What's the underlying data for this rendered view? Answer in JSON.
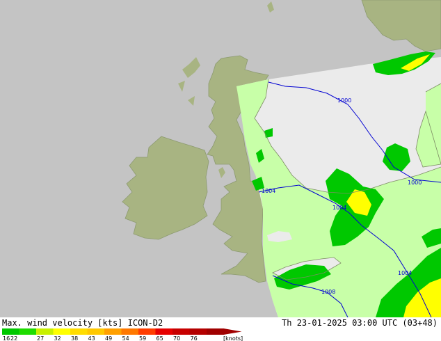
{
  "header": {
    "title": "Max. wind velocity [kts] ICON-D2",
    "valid_time": "Th 23-01-2025 03:00 UTC (03+48)"
  },
  "legend": {
    "ticks": [
      "16",
      "22",
      "27",
      "32",
      "38",
      "43",
      "49",
      "54",
      "59",
      "65",
      "70",
      "76"
    ],
    "unit": "[knots]",
    "colors": [
      "#00c800",
      "#1edc00",
      "#c8f000",
      "#ffff00",
      "#ffdc00",
      "#ffc800",
      "#ffa000",
      "#ff7800",
      "#ff3c00",
      "#e60000",
      "#c80000",
      "#b40000",
      "#a00000"
    ]
  },
  "isobars": [
    {
      "label": "1000",
      "id": "north"
    },
    {
      "label": "1000",
      "id": "east"
    },
    {
      "label": "1004",
      "id": "mid-west"
    },
    {
      "label": "1004",
      "id": "mid-center"
    },
    {
      "label": "1004",
      "id": "south-east"
    },
    {
      "label": "1008",
      "id": "south"
    }
  ],
  "colors": {
    "sea": "#c4c4c4",
    "land_outside": "#a8b482",
    "coast": "#7d8c64",
    "model_sea": "#ebebeb",
    "model_land": "#c8ffa8",
    "isobar": "#0000d2"
  }
}
